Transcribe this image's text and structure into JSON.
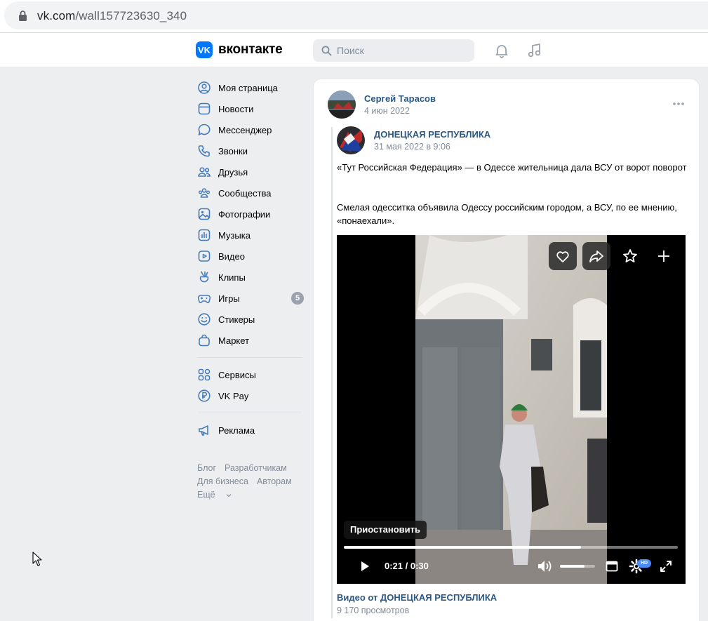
{
  "browser": {
    "url_domain": "vk.com",
    "url_path": "/wall157723630_340"
  },
  "header": {
    "logo_mark": "VK",
    "logo_text": "вконтакте",
    "search_placeholder": "Поиск",
    "icons": [
      "bell-icon",
      "music-icon"
    ]
  },
  "sidebar": {
    "items": [
      {
        "label": "Моя страница",
        "icon": "user-circle-icon"
      },
      {
        "label": "Новости",
        "icon": "news-icon"
      },
      {
        "label": "Мессенджер",
        "icon": "chat-bubble-icon"
      },
      {
        "label": "Звонки",
        "icon": "phone-icon"
      },
      {
        "label": "Друзья",
        "icon": "friends-icon"
      },
      {
        "label": "Сообщества",
        "icon": "communities-icon"
      },
      {
        "label": "Фотографии",
        "icon": "photo-icon"
      },
      {
        "label": "Музыка",
        "icon": "music-icon"
      },
      {
        "label": "Видео",
        "icon": "video-icon"
      },
      {
        "label": "Клипы",
        "icon": "clips-icon"
      },
      {
        "label": "Игры",
        "icon": "gamepad-icon",
        "badge": "5"
      },
      {
        "label": "Стикеры",
        "icon": "smile-icon"
      },
      {
        "label": "Маркет",
        "icon": "bag-icon"
      }
    ],
    "items2": [
      {
        "label": "Сервисы",
        "icon": "services-icon"
      },
      {
        "label": "VK Pay",
        "icon": "vkpay-icon"
      }
    ],
    "items3": [
      {
        "label": "Реклама",
        "icon": "megaphone-icon"
      }
    ],
    "footer": [
      "Блог",
      "Разработчикам",
      "Для бизнеса",
      "Авторам",
      "Ещё"
    ]
  },
  "post": {
    "author": "Сергей Тарасов",
    "date": "4 июн 2022",
    "repost": {
      "author": "ДОНЕЦКАЯ РЕСПУБЛИКА",
      "date": "31 мая 2022 в 9:06",
      "text1": "«Тут Российская Федерация» — в Одессе жительница дала ВСУ от ворот поворот",
      "text2": "Смелая одесситка объявила Одессу российским городом, а ВСУ, по ее мнению, «понаехали»."
    },
    "video": {
      "tooltip": "Приостановить",
      "time_current": "0:21",
      "time_total": "0:30",
      "progress": 0.71,
      "volume": 0.7,
      "hd_label": "HD",
      "title": "Видео от ДОНЕЦКАЯ РЕСПУБЛИКА",
      "views": "9 170 просмотров"
    }
  },
  "colors": {
    "accent": "#0077ff",
    "link": "#2a5885",
    "muted": "#818c99",
    "background": "#edeef0"
  }
}
